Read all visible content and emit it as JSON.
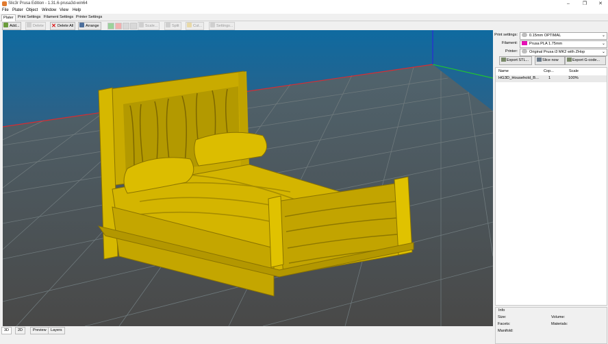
{
  "window": {
    "title": "Slic3r Prusa Edition - 1.31.6-prusa3d-win64",
    "minimize_glyph": "–",
    "maximize_glyph": "❐",
    "close_glyph": "✕"
  },
  "menu": [
    "File",
    "Plater",
    "Object",
    "Window",
    "View",
    "Help"
  ],
  "tabs": [
    "Plater",
    "Print Settings",
    "Filament Settings",
    "Printer Settings"
  ],
  "toolbar": {
    "add": "Add...",
    "delete": "Delete",
    "delete_all": "Delete All",
    "arrange": "Arrange",
    "scale": "Scale...",
    "split": "Split",
    "cut": "Cut...",
    "settings": "Settings..."
  },
  "bottom_tabs": [
    "3D",
    "2D",
    "Preview",
    "Layers"
  ],
  "settings": {
    "print_label": "Print settings:",
    "print_value": "0.15mm OPTIMAL",
    "filament_label": "Filament:",
    "filament_value": "Prusa PLA 1.75mm",
    "filament_color": "#e60fb5",
    "printer_label": "Printer:",
    "printer_value": "Original Prusa i3 MK2 with ZHop"
  },
  "actions": {
    "export_stl": "Export STL...",
    "slice_now": "Slice now",
    "export_gcode": "Export G-code..."
  },
  "object_list": {
    "columns": [
      "Name",
      "Cop...",
      "Scale"
    ],
    "rows": [
      {
        "name": "HG3D_Household_B...",
        "copies": "1",
        "scale": "100%"
      }
    ]
  },
  "info": {
    "title": "Info",
    "size_label": "Size:",
    "volume_label": "Volume:",
    "facets_label": "Facets:",
    "materials_label": "Materials:",
    "manifold_label": "Manifold:"
  },
  "colors": {
    "model": "#d1b300",
    "bg_top": "#0f6aa0",
    "bg_bottom": "#7a4b3a",
    "bed": "#4d5557",
    "axis_x": "#ff2020",
    "axis_y": "#21c52f",
    "axis_z": "#2a2ad8"
  }
}
